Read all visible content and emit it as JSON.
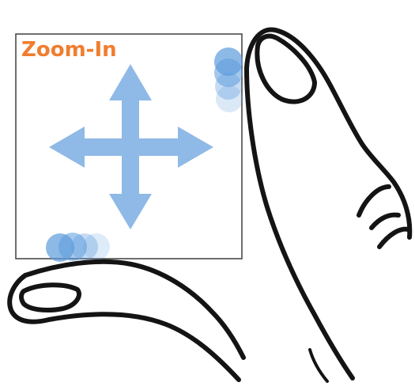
{
  "title": "Zoom-In",
  "colors": {
    "title": "#f07d2f",
    "arrow": "#8fb9e6",
    "touch": "#5b9bdc",
    "frame": "#4a4a4a",
    "outline": "#141414"
  },
  "icons": {
    "arrows": "four-way-arrow-icon",
    "touch_top": "touch-point-icon",
    "touch_bottom": "touch-point-icon",
    "hand": "pinch-hand-icon"
  }
}
